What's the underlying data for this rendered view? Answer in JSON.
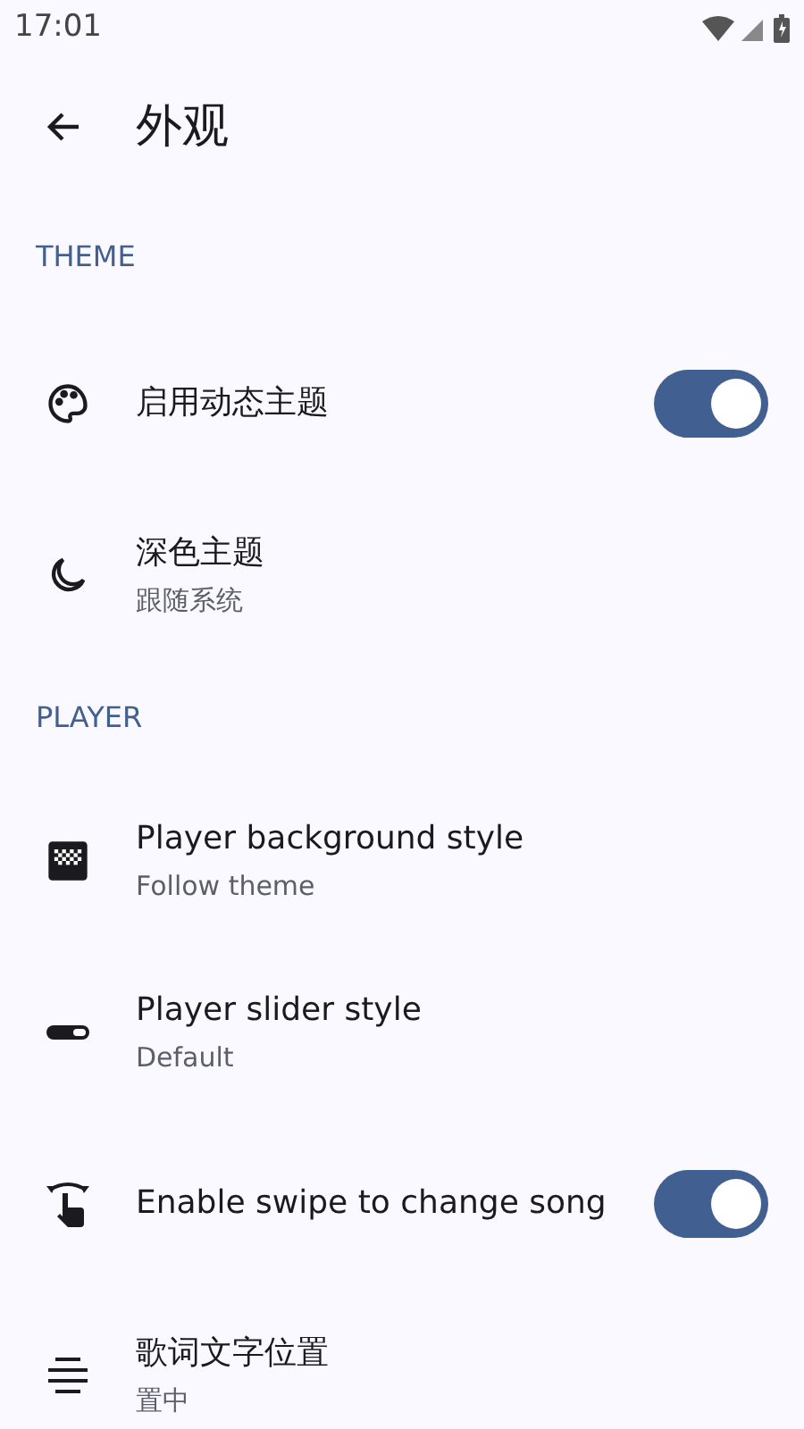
{
  "status_bar": {
    "time": "17:01"
  },
  "header": {
    "title": "外观"
  },
  "sections": [
    {
      "title": "THEME",
      "items": [
        {
          "kind": "toggle",
          "title": "启用动态主题",
          "on": true
        },
        {
          "kind": "value",
          "title": "深色主题",
          "subtitle": "跟随系统"
        }
      ]
    },
    {
      "title": "PLAYER",
      "items": [
        {
          "kind": "value",
          "title": "Player background style",
          "subtitle": "Follow theme"
        },
        {
          "kind": "value",
          "title": "Player slider style",
          "subtitle": "Default"
        },
        {
          "kind": "toggle",
          "title": "Enable swipe to change song",
          "on": true
        },
        {
          "kind": "value",
          "title": "歌词文字位置",
          "subtitle": "置中"
        }
      ]
    }
  ]
}
